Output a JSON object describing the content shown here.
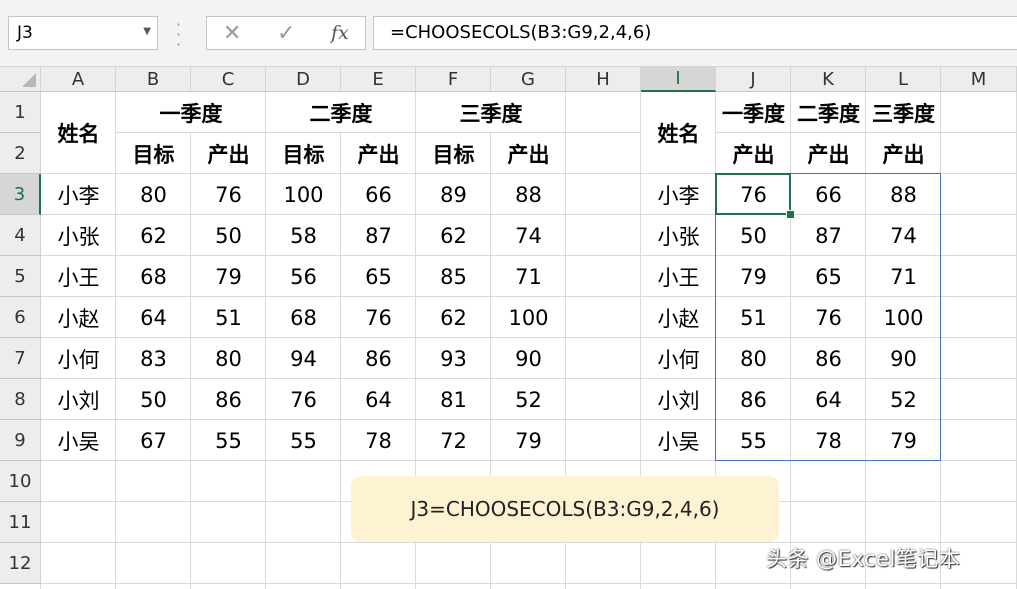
{
  "name_box": {
    "value": "J3"
  },
  "formula_bar": {
    "cancel_icon": "close-icon",
    "enter_icon": "check-icon",
    "fx_label": "fx",
    "formula": "=CHOOSECOLS(B3:G9,2,4,6)"
  },
  "sheet": {
    "columns": [
      "A",
      "B",
      "C",
      "D",
      "E",
      "F",
      "G",
      "H",
      "I",
      "J",
      "K",
      "L",
      "M"
    ],
    "rows": [
      "1",
      "2",
      "3",
      "4",
      "5",
      "6",
      "7",
      "8",
      "9",
      "10",
      "11",
      "12"
    ],
    "selected_cell": "J3",
    "source_table": {
      "name_header": "姓名",
      "quarters": [
        "一季度",
        "二季度",
        "三季度"
      ],
      "sub_headers": [
        "目标",
        "产出",
        "目标",
        "产出",
        "目标",
        "产出"
      ],
      "rows": [
        {
          "name": "小李",
          "values": [
            "80",
            "76",
            "100",
            "66",
            "89",
            "88"
          ]
        },
        {
          "name": "小张",
          "values": [
            "62",
            "50",
            "58",
            "87",
            "62",
            "74"
          ]
        },
        {
          "name": "小王",
          "values": [
            "68",
            "79",
            "56",
            "65",
            "85",
            "71"
          ]
        },
        {
          "name": "小赵",
          "values": [
            "64",
            "51",
            "68",
            "76",
            "62",
            "100"
          ]
        },
        {
          "name": "小何",
          "values": [
            "83",
            "80",
            "94",
            "86",
            "93",
            "90"
          ]
        },
        {
          "name": "小刘",
          "values": [
            "50",
            "86",
            "76",
            "64",
            "81",
            "52"
          ]
        },
        {
          "name": "小吴",
          "values": [
            "67",
            "55",
            "55",
            "78",
            "72",
            "79"
          ]
        }
      ]
    },
    "result_table": {
      "name_header": "姓名",
      "quarters": [
        "一季度",
        "二季度",
        "三季度"
      ],
      "sub_headers": [
        "产出",
        "产出",
        "产出"
      ],
      "rows": [
        {
          "name": "小李",
          "values": [
            "76",
            "66",
            "88"
          ]
        },
        {
          "name": "小张",
          "values": [
            "50",
            "87",
            "74"
          ]
        },
        {
          "name": "小王",
          "values": [
            "79",
            "65",
            "71"
          ]
        },
        {
          "name": "小赵",
          "values": [
            "51",
            "76",
            "100"
          ]
        },
        {
          "name": "小何",
          "values": [
            "80",
            "86",
            "90"
          ]
        },
        {
          "name": "小刘",
          "values": [
            "86",
            "64",
            "52"
          ]
        },
        {
          "name": "小吴",
          "values": [
            "55",
            "78",
            "79"
          ]
        }
      ]
    }
  },
  "note": "J3=CHOOSECOLS(B3:G9,2,4,6)",
  "watermark": "头条 @Excel笔记本",
  "colors": {
    "accent": "#217346",
    "range_border": "#4472c4",
    "note_bg": "#fdf2d2"
  }
}
